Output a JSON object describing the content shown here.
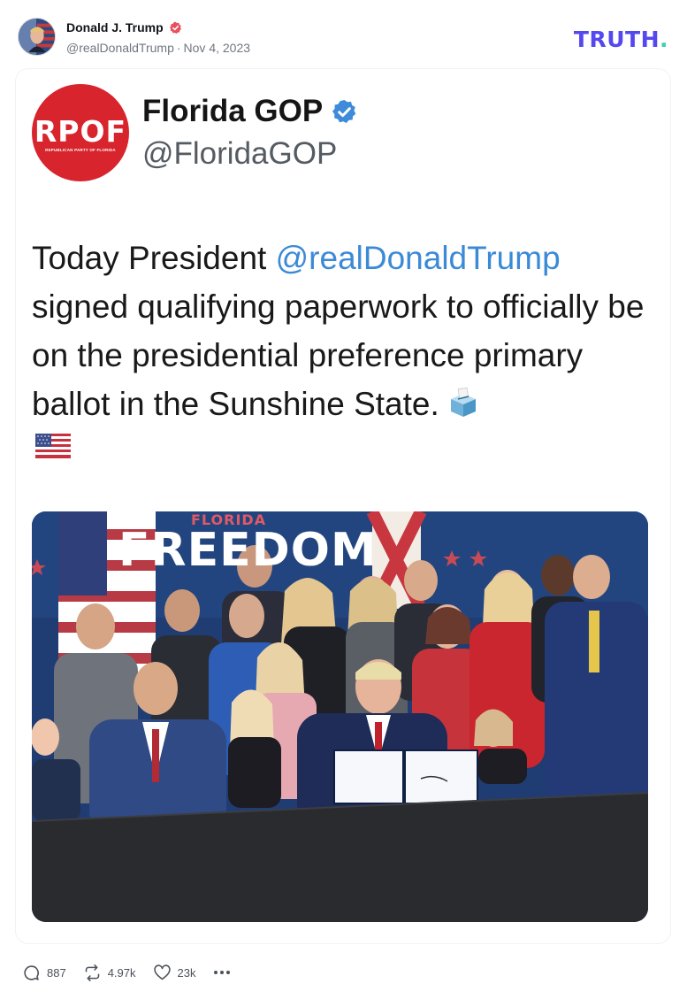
{
  "post": {
    "author_name": "Donald J. Trump",
    "author_handle": "@realDonaldTrump",
    "separator": "·",
    "date": "Nov 4, 2023",
    "brand": {
      "text": "TRUTH",
      "dot": ".",
      "color": "#5448ee",
      "dot_color": "#3ccfb0"
    },
    "verified_color": "#e8505b"
  },
  "embedded_tweet": {
    "logo_text": "RPOF",
    "logo_subtext": "REPUBLICAN PARTY OF FLORIDA",
    "logo_color": "#d8242d",
    "account_name": "Florida GOP",
    "account_handle": "@FloridaGOP",
    "text_before_mention": "Today President ",
    "mention": "@realDonaldTrump",
    "text_after_mention": " signed qualifying paperwork to officially be on the presidential preference primary ballot in the Sunshine State.",
    "mention_color": "#3b8ad6",
    "emojis": [
      "ballot-box-icon",
      "us-flag-icon"
    ]
  },
  "photo": {
    "banner_small": "FLORIDA",
    "banner_big": "FREEDOM",
    "description_icon": "signing-photo"
  },
  "actions": {
    "replies": "887",
    "retruths": "4.97k",
    "likes": "23k"
  }
}
